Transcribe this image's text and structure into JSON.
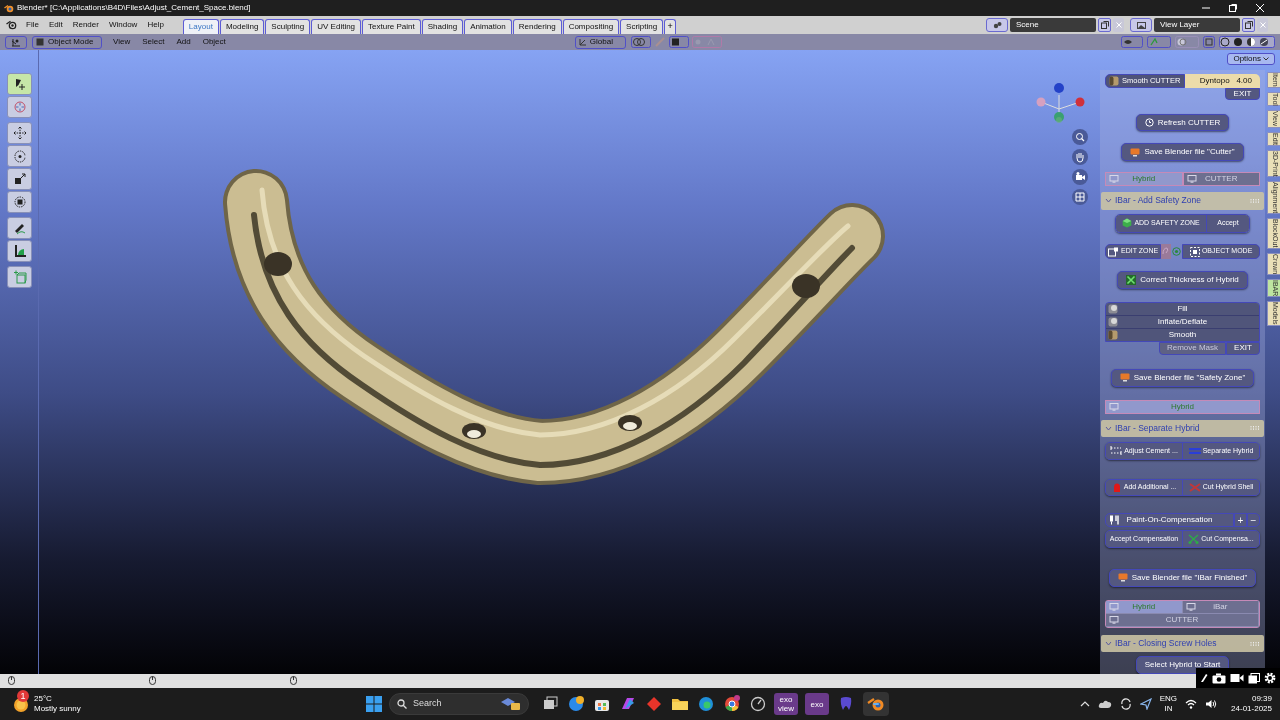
{
  "window": {
    "title": "Blender* [C:\\Applications\\B4D\\Files\\Adjust_Cement_Space.blend]"
  },
  "menu": [
    "File",
    "Edit",
    "Render",
    "Window",
    "Help"
  ],
  "workspaces": [
    {
      "label": "Layout",
      "selected": true
    },
    {
      "label": "Modeling",
      "selected": false
    },
    {
      "label": "Sculpting",
      "selected": false
    },
    {
      "label": "UV Editing",
      "selected": false
    },
    {
      "label": "Texture Paint",
      "selected": false
    },
    {
      "label": "Shading",
      "selected": false
    },
    {
      "label": "Animation",
      "selected": false
    },
    {
      "label": "Rendering",
      "selected": false
    },
    {
      "label": "Compositing",
      "selected": false
    },
    {
      "label": "Scripting",
      "selected": false
    }
  ],
  "add_workspace": "+",
  "scene": "Scene",
  "view_layer": "View Layer",
  "header": {
    "mode": "Object Mode",
    "menus": [
      "View",
      "Select",
      "Add",
      "Object"
    ],
    "orientation": "Global"
  },
  "options": "Options",
  "tools": [
    {
      "kind": "select",
      "selected": true
    },
    {
      "kind": "cursor",
      "selected": false
    },
    {
      "kind": "move",
      "selected": false
    },
    {
      "kind": "rotate",
      "selected": false
    },
    {
      "kind": "scale",
      "selected": false
    },
    {
      "kind": "transform",
      "selected": false
    },
    {
      "kind": "annotate",
      "selected": false
    },
    {
      "kind": "measure",
      "selected": false
    },
    {
      "kind": "add_cube",
      "selected": false
    }
  ],
  "sidebar_tabs": [
    {
      "label": "Item",
      "selected": false
    },
    {
      "label": "Tool",
      "selected": false
    },
    {
      "label": "View",
      "selected": false
    },
    {
      "label": "Edit",
      "selected": false
    },
    {
      "label": "3D-Print",
      "selected": false
    },
    {
      "label": "Alignment",
      "selected": false
    },
    {
      "label": "BlockOut",
      "selected": false
    },
    {
      "label": "Crown",
      "selected": false
    },
    {
      "label": "IBAR",
      "selected": true
    },
    {
      "label": "Models",
      "selected": false
    }
  ],
  "panel": [
    {
      "kind": "brush_row",
      "brush": "Smooth CUTTER",
      "label": "Dyntopo",
      "value": "4.00"
    },
    {
      "kind": "right_button",
      "label": "EXIT"
    },
    {
      "kind": "button",
      "label": "Refresh CUTTER"
    },
    {
      "kind": "button",
      "label": "Save Blender file \"Cutter\""
    },
    {
      "kind": "toggle_row",
      "items": [
        {
          "label": "Hybrid",
          "selected": true
        },
        {
          "label": "CUTTER",
          "selected": false
        }
      ]
    },
    {
      "kind": "section",
      "label": "IBar - Add Safety Zone",
      "expanded": true
    },
    {
      "kind": "pair",
      "items": [
        {
          "label": "ADD SAFETY ZONE"
        },
        {
          "label": "Accept"
        }
      ]
    },
    {
      "kind": "edit_row",
      "items": [
        {
          "label": "EDIT ZONE"
        },
        {
          "label": "OBJECT MODE"
        }
      ]
    },
    {
      "kind": "button",
      "label": "Correct Thickness of Hybrid"
    },
    {
      "kind": "brush_list",
      "items": [
        {
          "label": "Fill"
        },
        {
          "label": "Inflate/Deflate"
        },
        {
          "label": "Smooth"
        }
      ]
    },
    {
      "kind": "mask_row",
      "items": [
        {
          "label": "Remove Mask",
          "disabled": true
        },
        {
          "label": "EXIT",
          "disabled": false
        }
      ]
    },
    {
      "kind": "button",
      "label": "Save Blender file \"Safety Zone\""
    },
    {
      "kind": "toggle_row",
      "items": [
        {
          "label": "Hybrid",
          "selected": true
        }
      ]
    },
    {
      "kind": "section",
      "label": "IBar - Separate Hybrid",
      "expanded": true
    },
    {
      "kind": "pair",
      "items": [
        {
          "label": "Adjust Cement ..."
        },
        {
          "label": "Separate Hybrid"
        }
      ]
    },
    {
      "kind": "pair",
      "items": [
        {
          "label": "Add Additional ..."
        },
        {
          "label": "Cut Hybrid Shell"
        }
      ]
    },
    {
      "kind": "plusminus",
      "label": "Paint-On-Compensation",
      "plus": "+",
      "minus": "−"
    },
    {
      "kind": "pair",
      "items": [
        {
          "label": "Accept Compensation"
        },
        {
          "label": "Cut Compensa..."
        }
      ]
    },
    {
      "kind": "button",
      "label": "Save Blender file \"IBar Finished\""
    },
    {
      "kind": "toggle_grid",
      "items": [
        {
          "label": "Hybrid",
          "selected": true
        },
        {
          "label": "iBar",
          "selected": false
        },
        {
          "label": "CUTTER",
          "selected": false
        }
      ]
    },
    {
      "kind": "section",
      "label": "IBar - Closing Screw Holes",
      "expanded": true
    },
    {
      "kind": "button",
      "label": "Select Hybrid to Start"
    }
  ],
  "taskbar": {
    "badge": "1",
    "temperature": "25°C",
    "weather": "Mostly sunny",
    "search": "Search",
    "exo_apps": [
      {
        "lines": [
          "exo",
          "view"
        ]
      },
      {
        "lines": [
          "exo"
        ]
      }
    ],
    "language": "ENG",
    "region": "IN",
    "time": "09:39",
    "date": "24-01-2025"
  }
}
